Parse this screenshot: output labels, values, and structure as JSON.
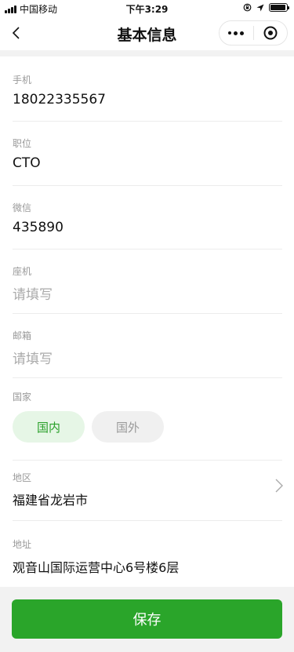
{
  "status_bar": {
    "carrier": "中国移动",
    "time": "下午3:29",
    "battery_level": 0.95
  },
  "nav": {
    "title": "基本信息"
  },
  "fields": {
    "phone": {
      "label": "手机",
      "value": "18022335567"
    },
    "position": {
      "label": "职位",
      "value": "CTO"
    },
    "wechat": {
      "label": "微信",
      "value": "435890"
    },
    "landline": {
      "label": "座机",
      "placeholder": "请填写"
    },
    "email": {
      "label": "邮箱",
      "placeholder": "请填写"
    },
    "country": {
      "label": "国家",
      "options": [
        "国内",
        "国外"
      ],
      "selected": "国内"
    },
    "region": {
      "label": "地区",
      "value": "福建省龙岩市"
    },
    "address": {
      "label": "地址",
      "value": "观音山国际运营中心6号楼6层"
    }
  },
  "actions": {
    "save_label": "保存"
  },
  "colors": {
    "accent": "#2aa52a",
    "pill_active_bg": "#e6f6e6",
    "pill_inactive_bg": "#f0f0f0"
  },
  "icons": {
    "back": "chevron-left-icon",
    "more": "more-dots-icon",
    "close": "capsule-close-icon",
    "region_arrow": "chevron-right-icon"
  }
}
